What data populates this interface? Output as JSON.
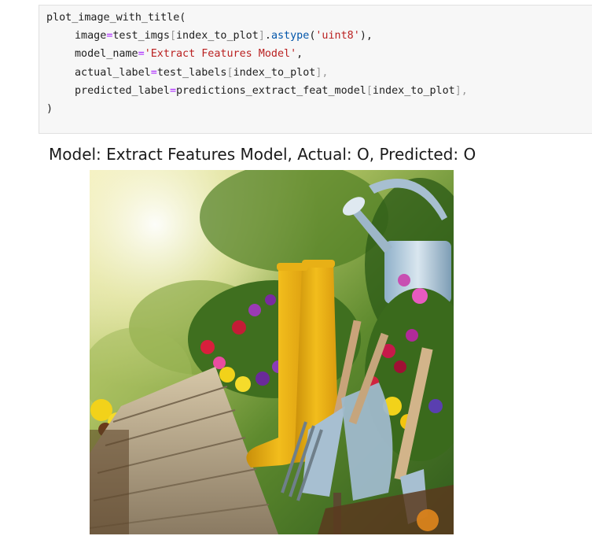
{
  "code_cell": {
    "lines": [
      [
        {
          "t": "plot_image_with_title(",
          "c": ""
        }
      ],
      [
        {
          "t": "image",
          "c": ""
        },
        {
          "t": "=",
          "c": "op"
        },
        {
          "t": "test_imgs",
          "c": ""
        },
        {
          "t": "[",
          "c": "br"
        },
        {
          "t": "index_to_plot",
          "c": ""
        },
        {
          "t": "]",
          "c": "br"
        },
        {
          "t": ".",
          "c": ""
        },
        {
          "t": "astype",
          "c": "attr"
        },
        {
          "t": "(",
          "c": ""
        },
        {
          "t": "'uint8'",
          "c": "str"
        },
        {
          "t": "),",
          "c": ""
        }
      ],
      [
        {
          "t": "model_name",
          "c": ""
        },
        {
          "t": "=",
          "c": "op"
        },
        {
          "t": "'Extract Features Model'",
          "c": "str"
        },
        {
          "t": ",",
          "c": ""
        }
      ],
      [
        {
          "t": "actual_label",
          "c": ""
        },
        {
          "t": "=",
          "c": "op"
        },
        {
          "t": "test_labels",
          "c": ""
        },
        {
          "t": "[",
          "c": "br"
        },
        {
          "t": "index_to_plot",
          "c": ""
        },
        {
          "t": "],",
          "c": "br"
        }
      ],
      [
        {
          "t": "predicted_label",
          "c": ""
        },
        {
          "t": "=",
          "c": "op"
        },
        {
          "t": "predictions_extract_feat_model",
          "c": ""
        },
        {
          "t": "[",
          "c": "br"
        },
        {
          "t": "index_to_plot",
          "c": ""
        },
        {
          "t": "],",
          "c": "br"
        }
      ],
      [
        {
          "t": ")",
          "c": ""
        }
      ]
    ],
    "indented_lines": [
      1,
      2,
      3,
      4
    ]
  },
  "output": {
    "title": "Model: Extract Features Model, Actual: O, Predicted: O"
  },
  "colors": {
    "cell_background": "#f7f7f7",
    "operator": "#aa22ff",
    "string": "#ba2121",
    "attribute": "#0055aa"
  }
}
